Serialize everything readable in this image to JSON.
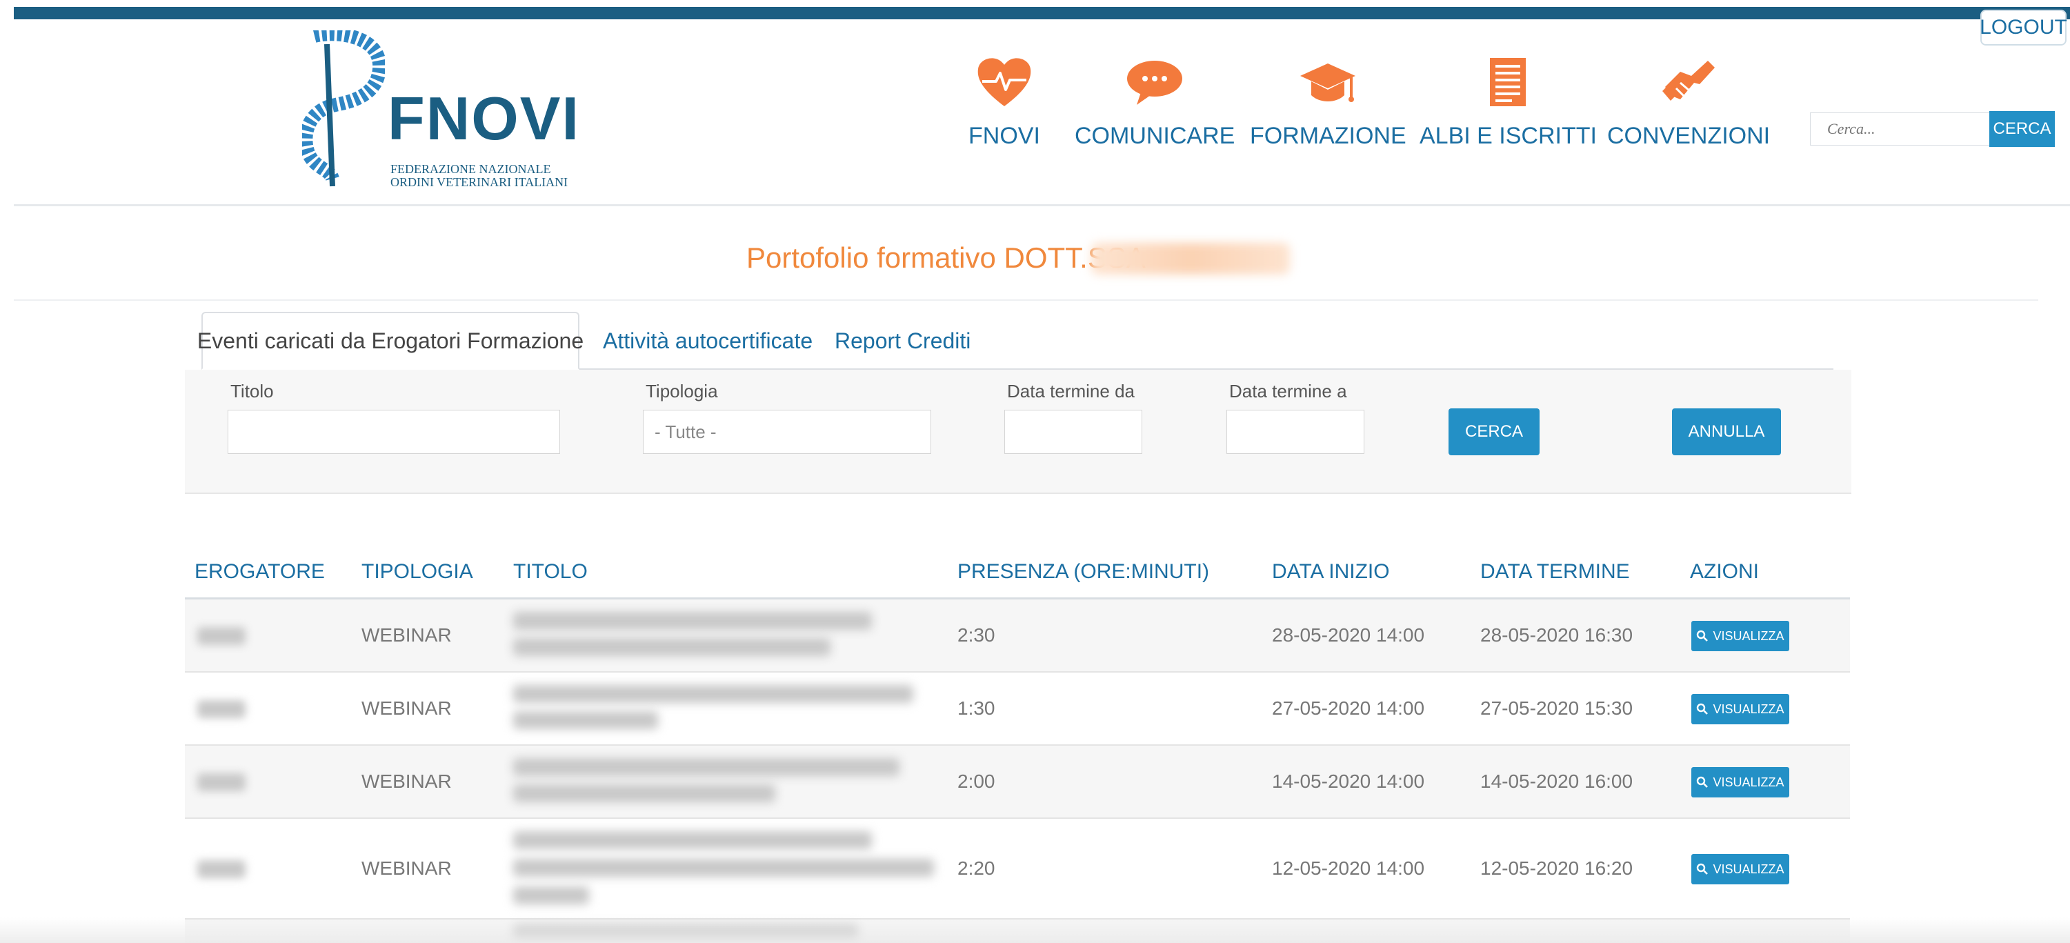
{
  "header": {
    "logout_label": "LOGOUT",
    "logo": {
      "name": "FNOVI",
      "subtitle_line1": "FEDERAZIONE NAZIONALE",
      "subtitle_line2": "ORDINI VETERINARI ITALIANI"
    },
    "nav": [
      {
        "label": "FNOVI",
        "icon": "heart-pulse-icon"
      },
      {
        "label": "COMUNICARE",
        "icon": "speech-bubble-icon"
      },
      {
        "label": "FORMAZIONE",
        "icon": "graduation-cap-icon"
      },
      {
        "label": "ALBI E ISCRITTI",
        "icon": "document-list-icon"
      },
      {
        "label": "CONVENZIONI",
        "icon": "handshake-icon"
      }
    ],
    "search": {
      "placeholder": "Cerca...",
      "button_label": "CERCA"
    }
  },
  "page": {
    "title": "Portofolio formativo DOTT.SSA"
  },
  "tabs": [
    {
      "label": "Eventi caricati da Erogatori Formazione",
      "active": true
    },
    {
      "label": "Attività autocertificate",
      "active": false
    },
    {
      "label": "Report Crediti",
      "active": false
    }
  ],
  "filters": {
    "titolo_label": "Titolo",
    "tipologia_label": "Tipologia",
    "tipologia_value": "- Tutte -",
    "data_da_label": "Data termine da",
    "data_a_label": "Data termine a",
    "cerca_label": "CERCA",
    "annulla_label": "ANNULLA"
  },
  "table": {
    "headers": [
      "EROGATORE",
      "TIPOLOGIA",
      "TITOLO",
      "PRESENZA (ORE:MINUTI)",
      "DATA INIZIO",
      "DATA TERMINE",
      "AZIONI"
    ],
    "action_label": "VISUALIZZA",
    "rows": [
      {
        "tipologia": "WEBINAR",
        "presenza": "2:30",
        "data_inizio": "28-05-2020 14:00",
        "data_termine": "28-05-2020 16:30"
      },
      {
        "tipologia": "WEBINAR",
        "presenza": "1:30",
        "data_inizio": "27-05-2020 14:00",
        "data_termine": "27-05-2020 15:30"
      },
      {
        "tipologia": "WEBINAR",
        "presenza": "2:00",
        "data_inizio": "14-05-2020 14:00",
        "data_termine": "14-05-2020 16:00"
      },
      {
        "tipologia": "WEBINAR",
        "presenza": "2:20",
        "data_inizio": "12-05-2020 14:00",
        "data_termine": "12-05-2020 16:20"
      }
    ]
  },
  "colors": {
    "brand_blue": "#1b5e82",
    "link_blue": "#1b6ea2",
    "button_blue": "#2390c6",
    "accent_orange": "#f0883c"
  }
}
